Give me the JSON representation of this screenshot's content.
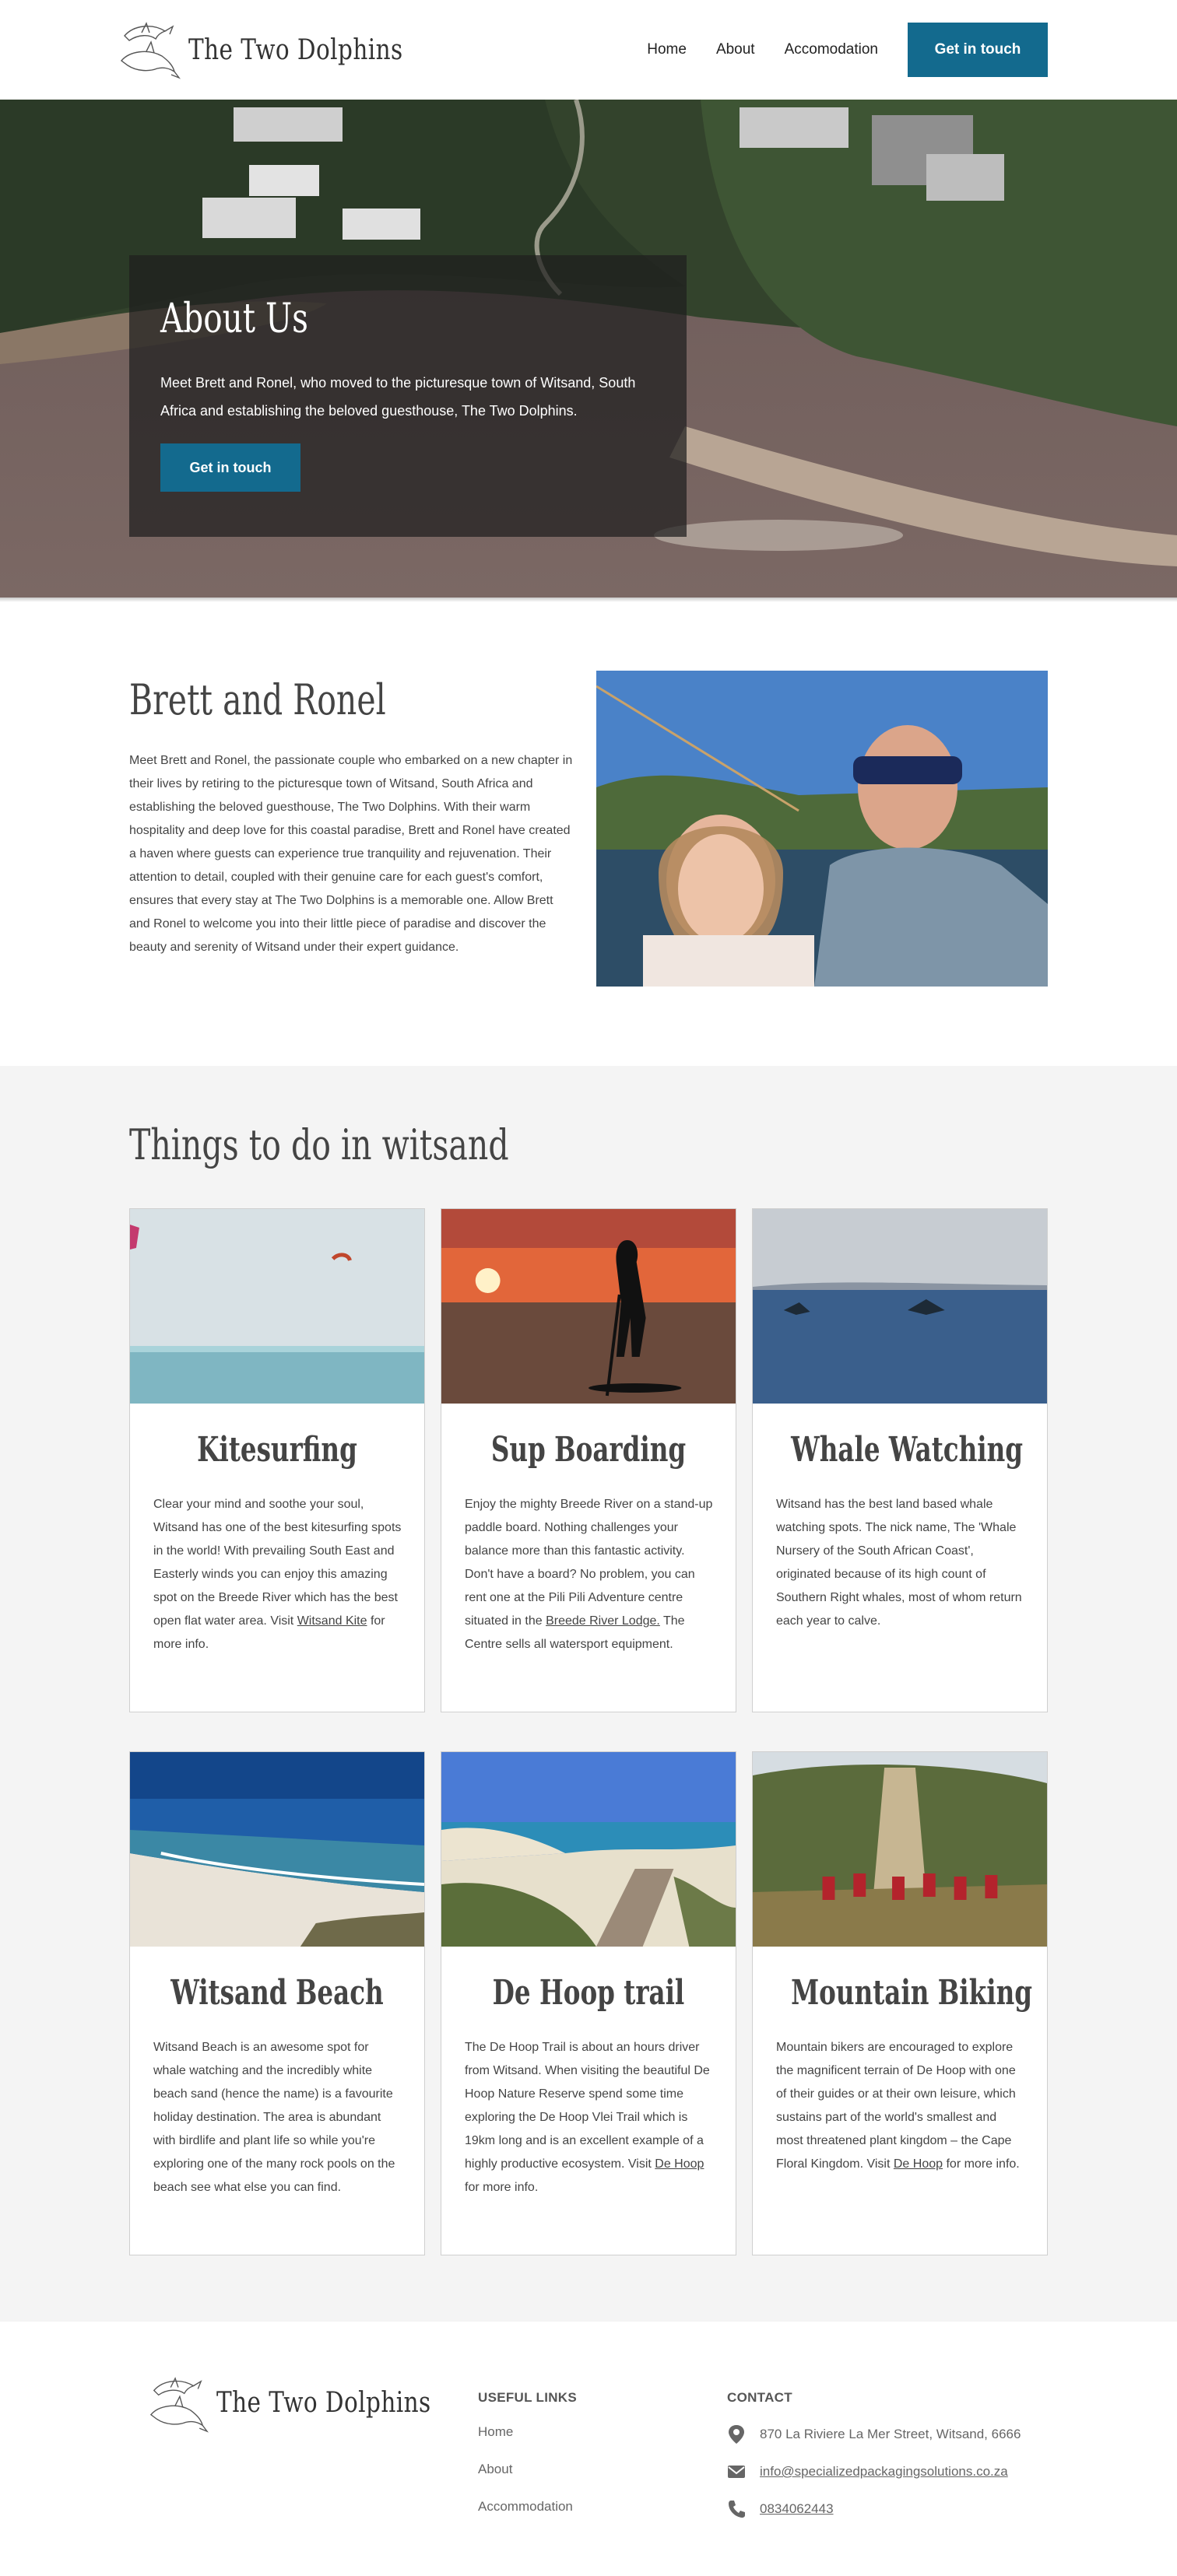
{
  "header": {
    "logo_text": "The Two Dolphins",
    "nav": [
      "Home",
      "About",
      "Accomodation"
    ],
    "cta": "Get in touch"
  },
  "hero": {
    "title": "About Us",
    "text": "Meet Brett and Ronel, who moved to the picturesque town of Witsand, South Africa and establishing the beloved guesthouse, The Two Dolphins.",
    "cta": "Get in touch"
  },
  "intro": {
    "title": "Brett and Ronel",
    "body": "Meet Brett and Ronel, the passionate couple who embarked on a new chapter in their lives by retiring to the picturesque town of Witsand, South Africa and establishing the beloved guesthouse, The Two Dolphins. With their warm hospitality and deep love for this coastal paradise, Brett and Ronel have created a haven where guests can experience true tranquility and rejuvenation. Their attention to detail, coupled with their genuine care for each guest's comfort, ensures that every stay at The Two Dolphins is a memorable one. Allow Brett and Ronel to welcome you into their little piece of paradise and discover the beauty and serenity of Witsand under their expert guidance."
  },
  "things": {
    "title": "Things to do in witsand",
    "cards": [
      {
        "title": "Kitesurfing",
        "before": "Clear your mind and soothe your soul, Witsand has one of the best kitesurfing spots in the world! With prevailing South East and Easterly winds you can enjoy this amazing spot on the Breede River which has the best open flat water area. Visit ",
        "link": "Witsand Kite",
        "after": " for more info."
      },
      {
        "title": "Sup Boarding",
        "before": "Enjoy the mighty Breede River on a stand-up paddle board. Nothing challenges your balance more than this fantastic activity. Don't have a board? No problem, you can rent one at the Pili Pili Adventure centre situated in the ",
        "link": "Breede River Lodge.",
        "after": " The Centre sells all watersport equipment."
      },
      {
        "title": "Whale Watching",
        "before": "Witsand has the best land based whale watching spots. The nick name, The 'Whale Nursery of the South African Coast', originated because of its high count of Southern Right whales, most of whom return each year to calve.",
        "link": "",
        "after": ""
      },
      {
        "title": "Witsand Beach",
        "before": "Witsand Beach is an awesome spot for whale watching and the incredibly white beach sand (hence the name) is a favourite holiday destination. The area is abundant with birdlife and plant life so while you're exploring one of the many rock pools on the beach see what else you can find.",
        "link": "",
        "after": ""
      },
      {
        "title": "De Hoop trail",
        "before": "The De Hoop Trail is about an hours driver from Witsand. When visiting the beautiful De Hoop Nature Reserve spend some time exploring the De Hoop Vlei Trail which is 19km long and is an excellent example of a highly productive ecosystem. Visit ",
        "link": "De Hoop",
        "after": " for more info."
      },
      {
        "title": "Mountain Biking",
        "before": "Mountain bikers are encouraged to explore the magnificent terrain of De Hoop with one of their guides or at their own leisure, which sustains part of the world's smallest and most threatened plant kingdom – the Cape Floral Kingdom. Visit ",
        "link": "De Hoop",
        "after": " for more info."
      }
    ]
  },
  "footer": {
    "logo_text": "The Two Dolphins",
    "links_title": "USEFUL LINKS",
    "links": [
      "Home",
      "About",
      "Accommodation"
    ],
    "contact_title": "CONTACT",
    "address": "870 La Riviere La Mer Street, Witsand, 6666",
    "email": "info@specializedpackagingsolutions.co.za",
    "phone": "0834062443"
  },
  "colors": {
    "accent": "#136a8e",
    "section_bg": "#f4f4f4"
  },
  "icons": [
    "dolphin-logo-icon",
    "map-pin-icon",
    "envelope-icon",
    "phone-icon"
  ]
}
